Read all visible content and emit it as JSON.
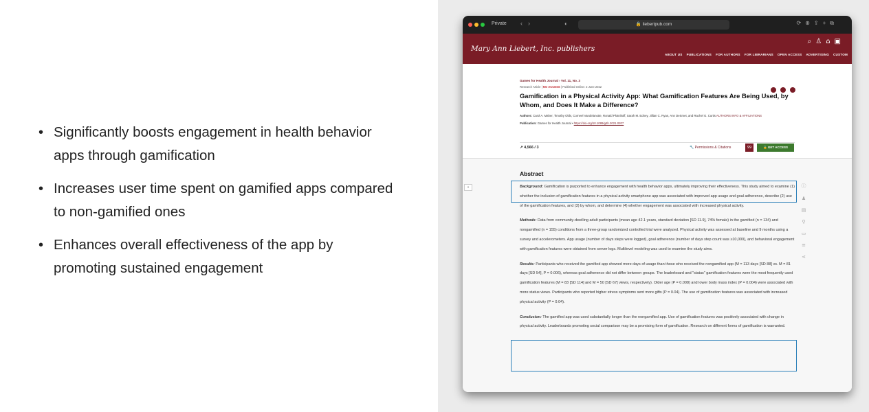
{
  "slide": {
    "bullets": [
      "Significantly boosts engagement in health behavior apps through gamification",
      "Increases user time spent on gamified apps compared to non-gamified ones",
      "Enhances overall effectiveness of the app by promoting sustained engagement"
    ]
  },
  "browser": {
    "tab_label": "Private",
    "url": "liebertpub.com"
  },
  "site": {
    "logo": "Mary Ann Liebert, Inc. publishers",
    "nav": [
      "ABOUT US",
      "PUBLICATIONS",
      "FOR AUTHORS",
      "FOR LIBRARIANS",
      "OPEN ACCESS",
      "ADVERTISING",
      "CUSTOM"
    ]
  },
  "article": {
    "breadcrumb": "Games for Health Journal  ›  Vol. 11, No. 3",
    "type": "Research Article",
    "access": "NO ACCESS",
    "published": "Published Online: 2 June 2022",
    "title": "Gamification in a Physical Activity App: What Gamification Features Are Being Used, by Whom, and Does It Make a Difference?",
    "authors_label": "Authors:",
    "authors": "Carol A. Maher, Timothy Olds, Corneel Vandelanotte, Ronald Plotnikoff, Sarah M. Edney, Jillian C. Ryan, Ann DeSmet, and Rachel G. Curtis",
    "authors_info": "AUTHORS INFO & AFFILIATIONS",
    "publication_label": "Publication:",
    "publication": "Games for Health Journal",
    "doi": "https://doi.org/10.1089/g4h.2021.0207",
    "metrics": "4,566 / 3",
    "permissions": "Permissions & Citations",
    "get_access": "GET ACCESS"
  },
  "abstract": {
    "heading": "Abstract",
    "background_label": "Background:",
    "background": "Gamification is purported to enhance engagement with health behavior apps, ultimately improving their effectiveness. This study aimed to examine (1) whether the inclusion of gamification features in a physical activity smartphone app was associated with improved app usage and goal adherence, describe (2) use of the gamification features, and (3) by whom, and determine (4) whether engagement was associated with increased physical activity.",
    "methods_label": "Methods:",
    "methods": "Data from community-dwelling adult participants (mean age 42.1 years, standard deviation [SD 11.9], 74% female) in the gamified (n = 134) and nongamified (n = 155) conditions from a three-group randomized controlled trial were analyzed. Physical activity was assessed at baseline and 9 months using a survey and accelerometers. App usage (number of days steps were logged), goal adherence (number of days step count was ≥10,000), and behavioral engagement with gamification features were obtained from server logs. Multilevel modeling was used to examine the study aims.",
    "results_label": "Results:",
    "results": "Participants who received the gamified app showed more days of usage than those who received the nongamified app (M = 113 days [SD 88] vs. M = 81 days [SD 54], P = 0.006), whereas goal adherence did not differ between groups. The leaderboard and \"status\" gamification features were the most frequently used gamification features (M = 83 [SD 114] and M = 50 [SD 67] views, respectively). Older age (P = 0.008) and lower body mass index (P = 0.004) were associated with more status views. Participants who reported higher stress symptoms sent more gifts (P = 0.04). The use of gamification features was associated with increased physical activity (P = 0.04).",
    "conclusion_label": "Conclusion:",
    "conclusion": "The gamified app was used substantially longer than the nongamified app. Use of gamification features was positively associated with change in physical activity. Leaderboards promoting social comparison may be a promising form of gamification. Research on different forms of gamification is warranted."
  },
  "colors": {
    "brand": "#7a1c26",
    "access_button": "#3d7a2e",
    "highlight_box": "#2a7fb8"
  }
}
